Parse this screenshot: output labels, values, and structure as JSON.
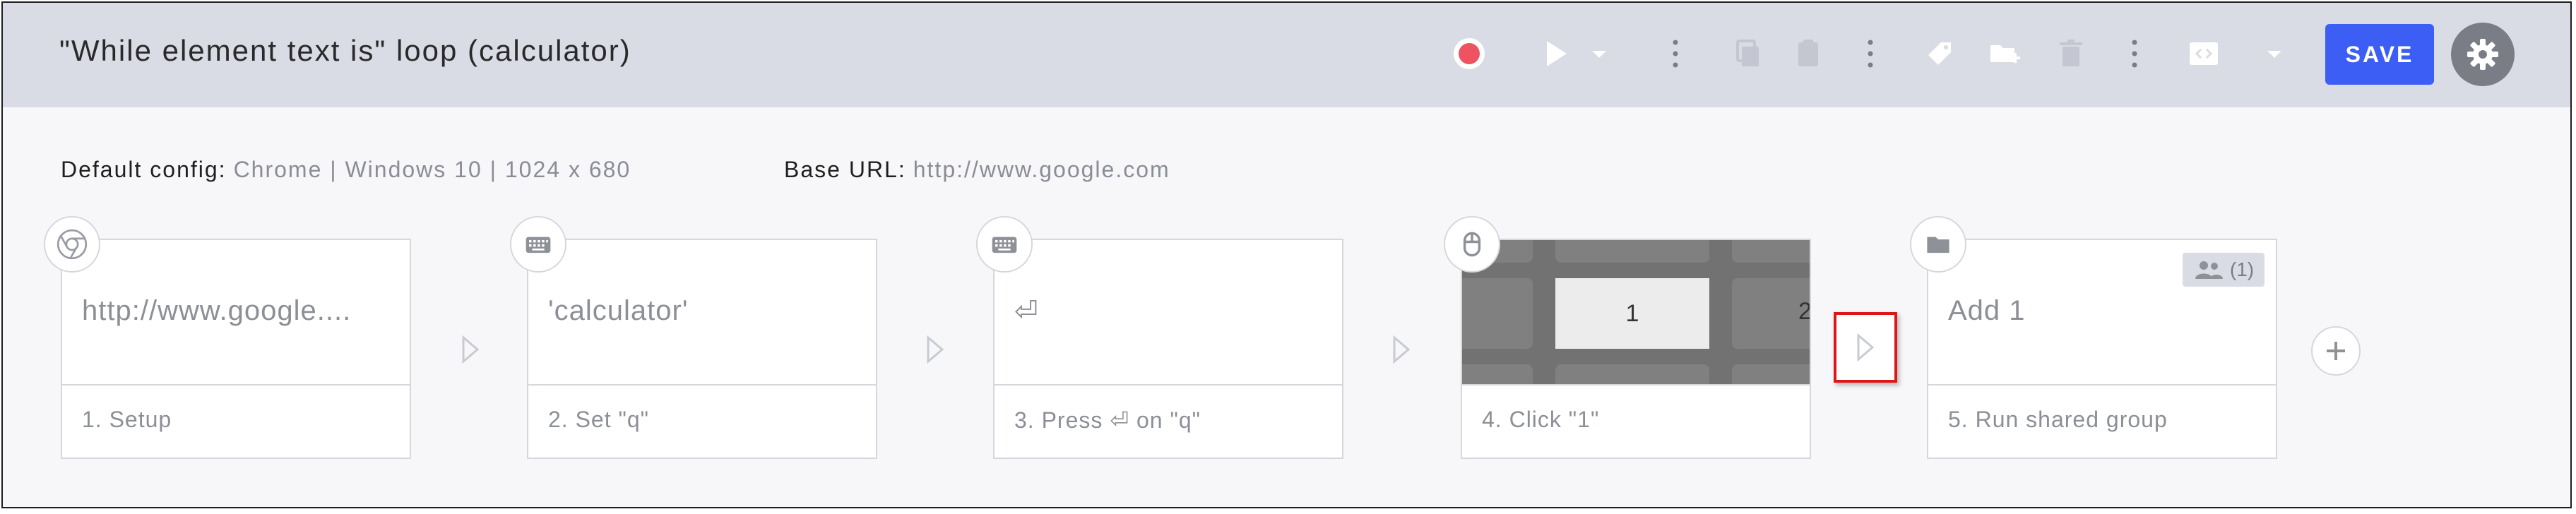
{
  "header": {
    "title": "\"While element text is\" loop (calculator)",
    "save_label": "SAVE",
    "icons": [
      "record-icon",
      "play-icon",
      "play-dropdown-icon",
      "more-vertical-icon",
      "copy-icon",
      "paste-icon",
      "more-vertical-icon",
      "tag-icon",
      "add-folder-icon",
      "delete-icon",
      "more-vertical-icon",
      "code-icon",
      "code-dropdown-icon",
      "gear-icon"
    ],
    "colors": {
      "record": "#ef5261",
      "save": "#3d5ef5",
      "header_bg": "#d9dbe5"
    }
  },
  "config": {
    "default_label": "Default config:",
    "default_value": "Chrome | Windows 10 | 1024 x 680",
    "base_label": "Base URL:",
    "base_value": "http://www.google.com"
  },
  "steps": [
    {
      "preview": "http://www.google....",
      "label": "1. Setup",
      "icon": "chrome-icon"
    },
    {
      "preview": "'calculator'",
      "label": "2. Set \"q\"",
      "icon": "keyboard-icon"
    },
    {
      "preview": "⏎",
      "label": "3. Press ⏎ on \"q\"",
      "icon": "keyboard-icon"
    },
    {
      "preview_button": "1",
      "preview_edge": "2",
      "label": "4. Click \"1\"",
      "icon": "mouse-icon"
    },
    {
      "preview": "Add 1",
      "label": "5. Run shared group",
      "icon": "folder-icon",
      "shared_count": "(1)"
    }
  ]
}
